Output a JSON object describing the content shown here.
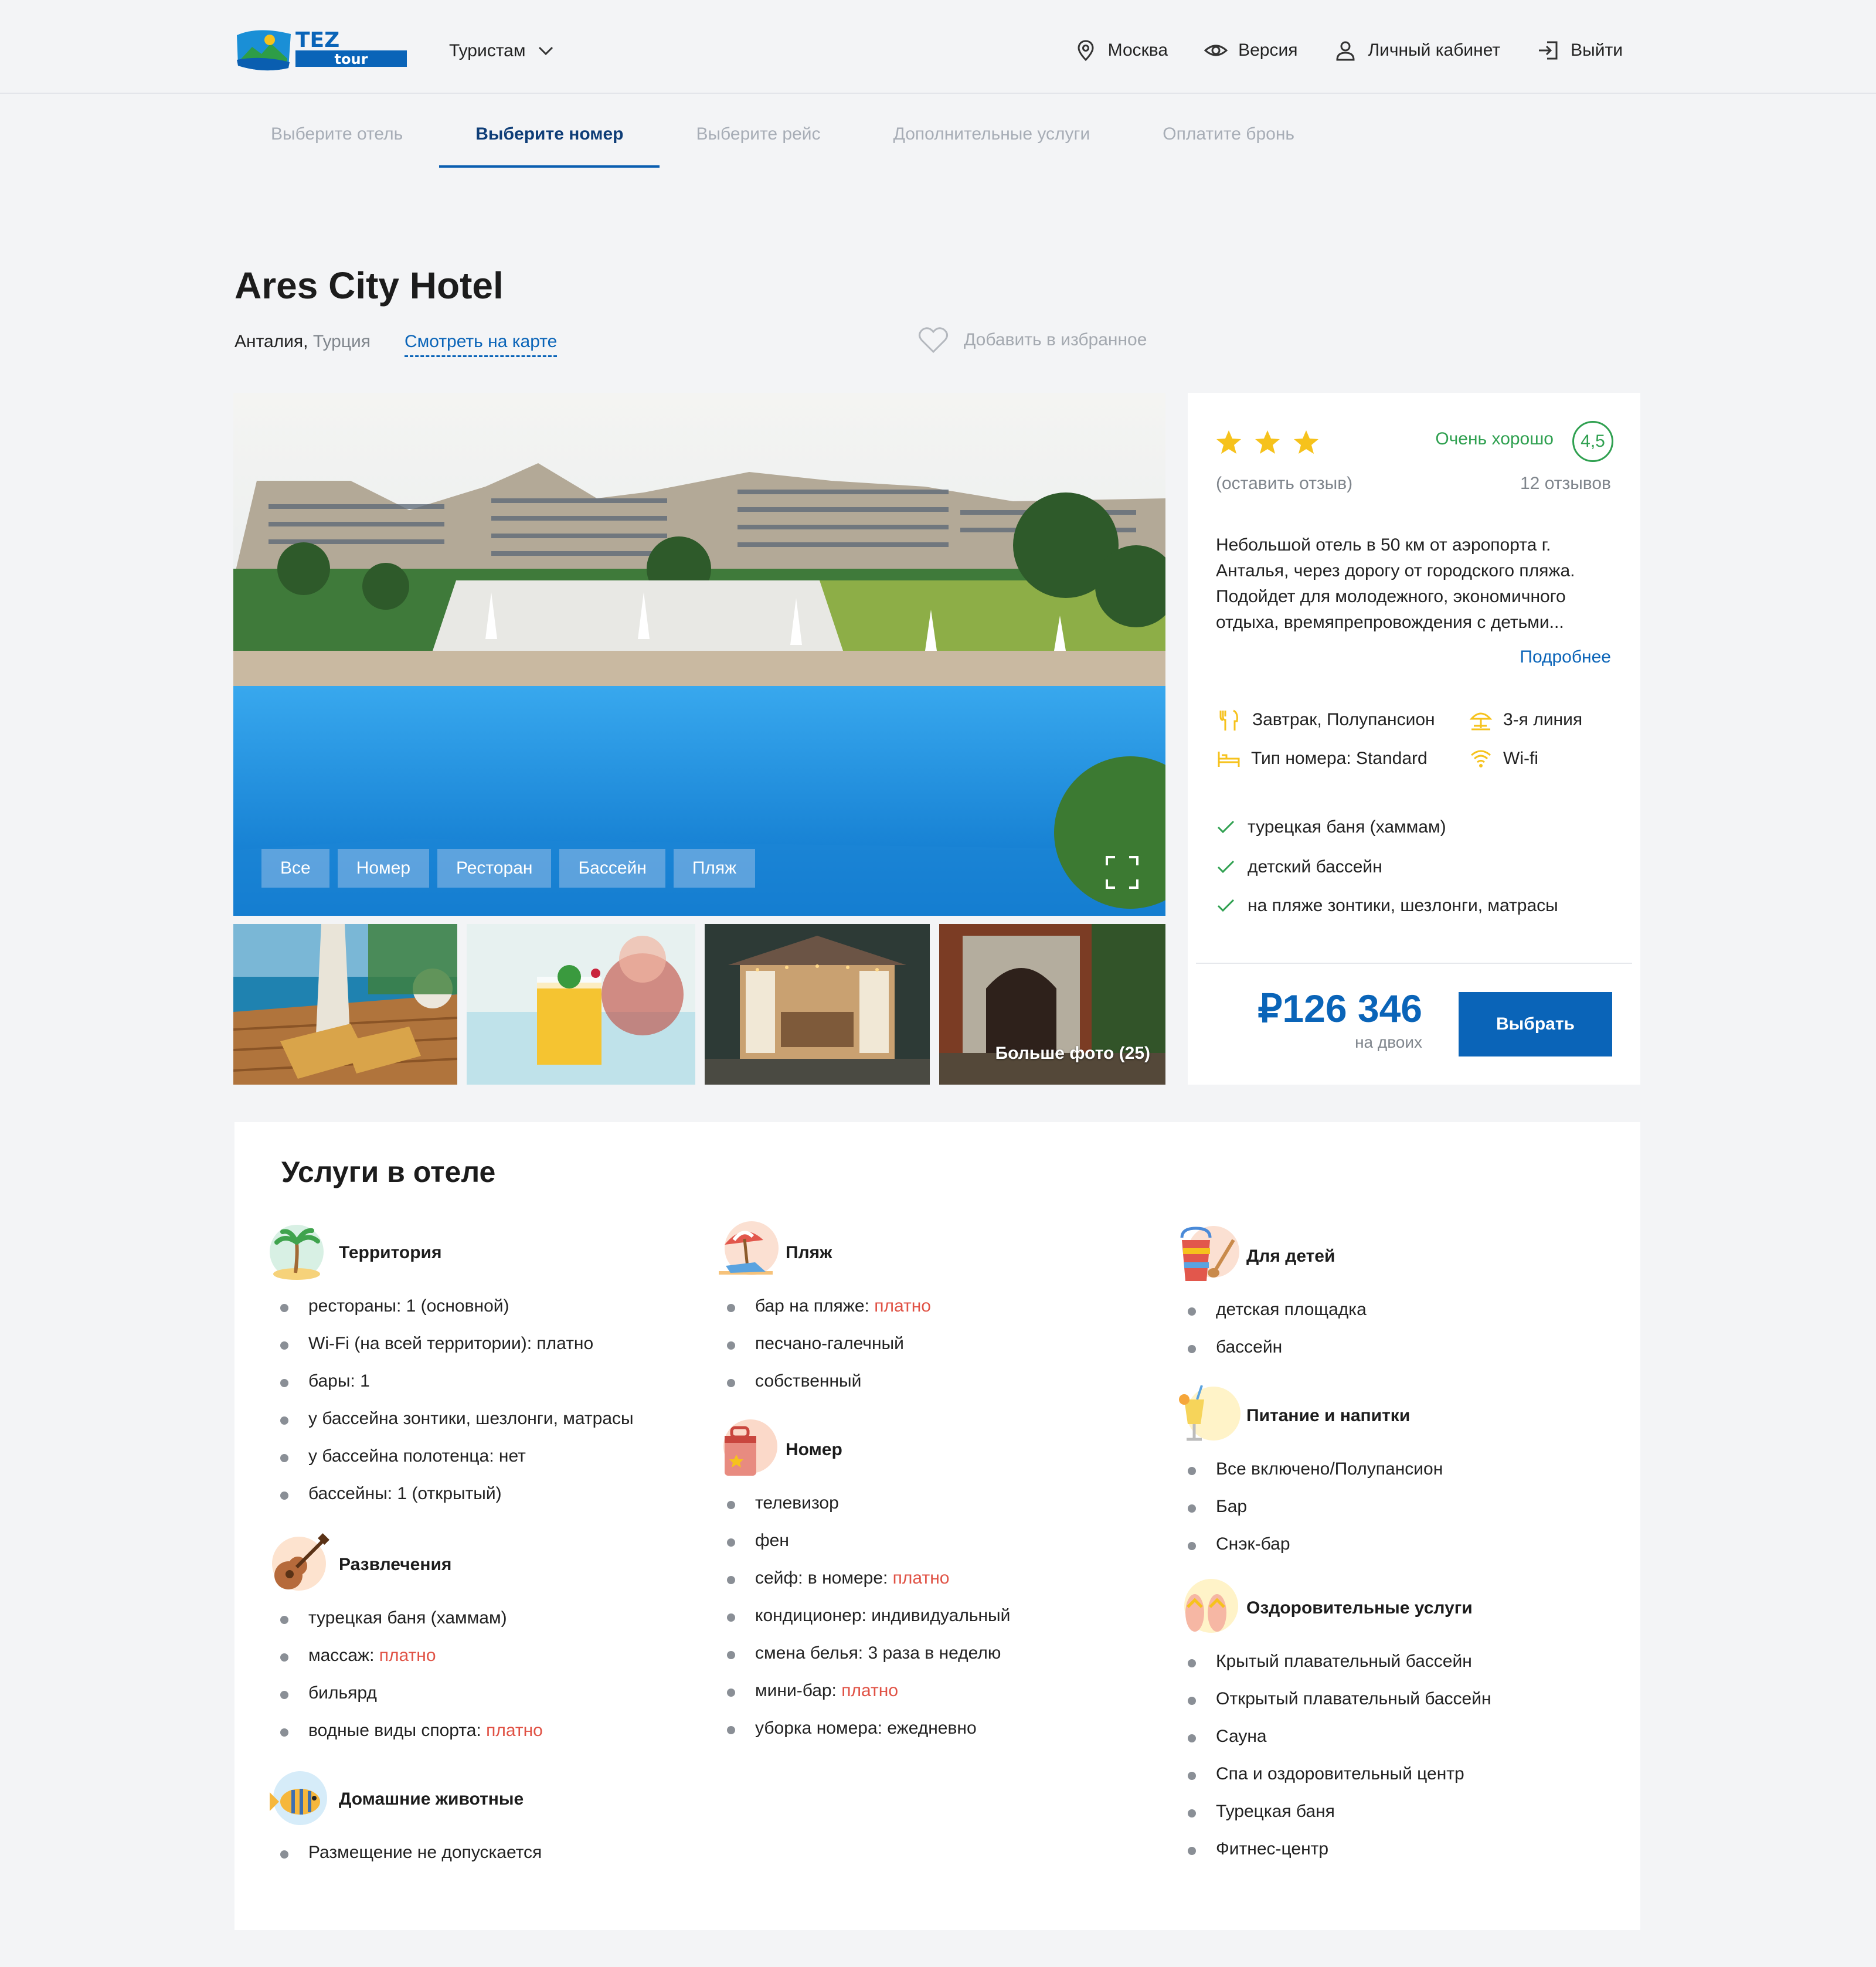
{
  "header": {
    "logo_text_top": "TEZ",
    "logo_text_bottom": "tour",
    "tourists": "Туристам",
    "nav": {
      "city": "Москва",
      "version": "Версия",
      "account": "Личный кабинет",
      "logout": "Выйти"
    }
  },
  "steps": [
    "Выберите отель",
    "Выберите номер",
    "Выберите рейс",
    "Дополнительные услуги",
    "Оплатите бронь"
  ],
  "active_step": 1,
  "hotel": {
    "name": "Ares City Hotel",
    "city": "Анталия,",
    "country": "Турция",
    "map_link": "Смотреть на карте",
    "favorite": "Добавить в избранное"
  },
  "gallery": {
    "tabs": [
      "Все",
      "Номер",
      "Ресторан",
      "Бассейн",
      "Пляж"
    ],
    "more_photos": "Больше фото (25)"
  },
  "card": {
    "stars": 3,
    "rating_text": "Очень хорошо",
    "rating_value": "4,5",
    "leave_review": "(оставить отзыв)",
    "reviews_count": "12 отзывов",
    "description": "Небольшой отель в 50 км от аэропорта г. Анталья, через дорогу от городского пляжа. Подойдет для молодежного, экономичного отдыха, времяпрепровождения с детьми...",
    "more": "Подробнее",
    "meal": "Завтрак, Полупансион",
    "line": "3-я линия",
    "room_type": "Тип номера: Standard",
    "wifi": "Wi-fi",
    "checks": [
      "турецкая баня (хаммам)",
      "детский бассейн",
      "на пляже зонтики, шезлонги, матрасы"
    ],
    "price": "₽126 346",
    "price_sub": "на двоих",
    "choose": "Выбрать"
  },
  "services": {
    "title": "Услуги в отеле",
    "groups": {
      "territory": {
        "title": "Территория",
        "items": [
          {
            "text": "рестораны: 1 (основной)",
            "paid": ""
          },
          {
            "text": "Wi-Fi (на всей территории): платно",
            "paid": ""
          },
          {
            "text": "бары: 1",
            "paid": ""
          },
          {
            "text": "у бассейна зонтики, шезлонги, матрасы",
            "paid": ""
          },
          {
            "text": "у бассейна полотенца: нет",
            "paid": ""
          },
          {
            "text": "бассейны: 1 (открытый)",
            "paid": ""
          }
        ]
      },
      "entertainment": {
        "title": "Развлечения",
        "items": [
          {
            "text": "турецкая баня (хаммам)",
            "paid": ""
          },
          {
            "text": "массаж: ",
            "paid": "платно"
          },
          {
            "text": " бильярд",
            "paid": ""
          },
          {
            "text": "водные виды спорта: ",
            "paid": "платно"
          }
        ]
      },
      "pets": {
        "title": "Домашние животные",
        "items": [
          {
            "text": "Размещение не допускается",
            "paid": ""
          }
        ]
      },
      "beach": {
        "title": "Пляж",
        "items": [
          {
            "text": "бар на пляже: ",
            "paid": "платно"
          },
          {
            "text": " песчано-галечный",
            "paid": ""
          },
          {
            "text": " собственный",
            "paid": ""
          }
        ]
      },
      "room": {
        "title": "Номер",
        "items": [
          {
            "text": "телевизор",
            "paid": ""
          },
          {
            "text": " фен",
            "paid": ""
          },
          {
            "text": " сейф: в номере: ",
            "paid": "платно"
          },
          {
            "text": " кондиционер: индивидуальный",
            "paid": ""
          },
          {
            "text": " смена белья: 3 раза в неделю",
            "paid": ""
          },
          {
            "text": " мини-бар: ",
            "paid": "платно"
          },
          {
            "text": " уборка номера: ежедневно",
            "paid": ""
          }
        ]
      },
      "kids": {
        "title": "Для детей",
        "items": [
          {
            "text": " детская площадка",
            "paid": ""
          },
          {
            "text": "бассейн",
            "paid": ""
          }
        ]
      },
      "food": {
        "title": "Питание и напитки",
        "items": [
          {
            "text": "Все включено/Полупансион",
            "paid": ""
          },
          {
            "text": "Бар",
            "paid": ""
          },
          {
            "text": "Снэк-бар",
            "paid": ""
          }
        ]
      },
      "health": {
        "title": "Оздоровительные услуги",
        "items": [
          {
            "text": "Крытый плавательный бассейн",
            "paid": ""
          },
          {
            "text": "Открытый плавательный бассейн",
            "paid": ""
          },
          {
            "text": "Сауна",
            "paid": ""
          },
          {
            "text": "Спа и оздоровительный центр",
            "paid": ""
          },
          {
            "text": "Турецкая баня",
            "paid": ""
          },
          {
            "text": "Фитнес-центр",
            "paid": ""
          }
        ]
      }
    }
  },
  "colors": {
    "brand_blue": "#0a64b8",
    "rating_green": "#2fa050",
    "paid_red": "#e05245",
    "star_yellow": "#f6c21c"
  }
}
